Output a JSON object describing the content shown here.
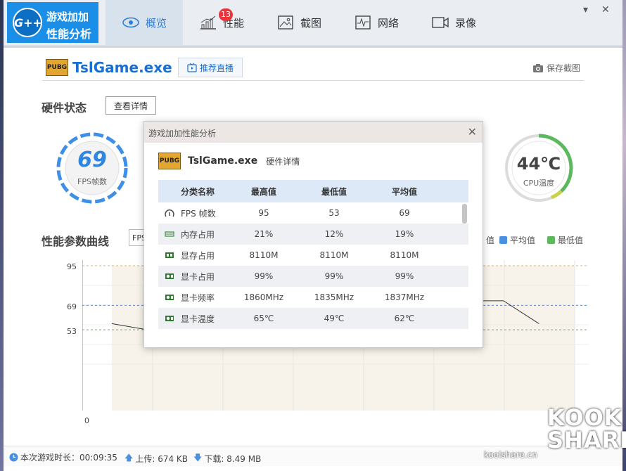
{
  "app": {
    "logo_mark": "G++",
    "logo_line1": "游戏加加",
    "logo_line2": "性能分析"
  },
  "tabs": [
    {
      "label": "概览",
      "icon": "eye-icon",
      "active": true
    },
    {
      "label": "性能",
      "icon": "bar-chart-icon"
    },
    {
      "label": "截图",
      "icon": "image-icon",
      "badge": "13"
    },
    {
      "label": "网络",
      "icon": "pulse-icon"
    },
    {
      "label": "录像",
      "icon": "video-camera-icon"
    }
  ],
  "window_controls": {
    "minimize": "▾",
    "close": "✕"
  },
  "game": {
    "logo_text": "PUBG",
    "name": "TslGame.exe",
    "recommend_label": "推荐直播",
    "save_screenshot": "保存截图"
  },
  "hardware": {
    "title": "硬件状态",
    "detail_button": "查看详情",
    "fps_value": "69",
    "fps_label": "FPS帧数",
    "cpu_temp_value": "44℃",
    "cpu_temp_label": "CPU温度"
  },
  "curve": {
    "title": "性能参数曲线",
    "select_value": "FPS",
    "legend_peek": "值",
    "legend": [
      {
        "label": "平均值",
        "color": "#4a90e2"
      },
      {
        "label": "最低值",
        "color": "#5cb85c"
      }
    ]
  },
  "chart_data": {
    "type": "line",
    "yticks": [
      "95",
      "69",
      "53",
      "0"
    ],
    "ylim": [
      0,
      100
    ],
    "max": 95,
    "avg": 69,
    "min": 53,
    "series": [
      {
        "x": [
          0,
          1
        ],
        "values": [
          57,
          53
        ]
      },
      {
        "x": [
          10,
          11,
          12
        ],
        "values": [
          72,
          72,
          57
        ]
      }
    ]
  },
  "status": {
    "duration": "本次游戏时长：00:09:35",
    "upload": "上传: 674 KB",
    "download": "下载: 8.49 MB"
  },
  "dialog": {
    "title": "游戏加加性能分析",
    "game_logo": "PUBG",
    "game_name": "TslGame.exe",
    "subtitle": "硬件详情",
    "headers": [
      "分类名称",
      "最高值",
      "最低值",
      "平均值"
    ],
    "rows": [
      {
        "icon": "gauge-icon",
        "name": "FPS 帧数",
        "max": "95",
        "min": "53",
        "avg": "69"
      },
      {
        "icon": "ram-icon",
        "name": "内存占用",
        "max": "21%",
        "min": "12%",
        "avg": "19%"
      },
      {
        "icon": "vram-icon",
        "name": "显存占用",
        "max": "8110M",
        "min": "8110M",
        "avg": "8110M"
      },
      {
        "icon": "gpu-card-icon",
        "name": "显卡占用",
        "max": "99%",
        "min": "99%",
        "avg": "99%"
      },
      {
        "icon": "gpu-card-icon",
        "name": "显卡频率",
        "max": "1860MHz",
        "min": "1835MHz",
        "avg": "1837MHz"
      },
      {
        "icon": "gpu-card-icon",
        "name": "显卡温度",
        "max": "65℃",
        "min": "49℃",
        "avg": "62℃"
      }
    ]
  },
  "watermark": {
    "line1": "KOOK",
    "line2": "SHARE",
    "site": "koolshare.cn"
  }
}
